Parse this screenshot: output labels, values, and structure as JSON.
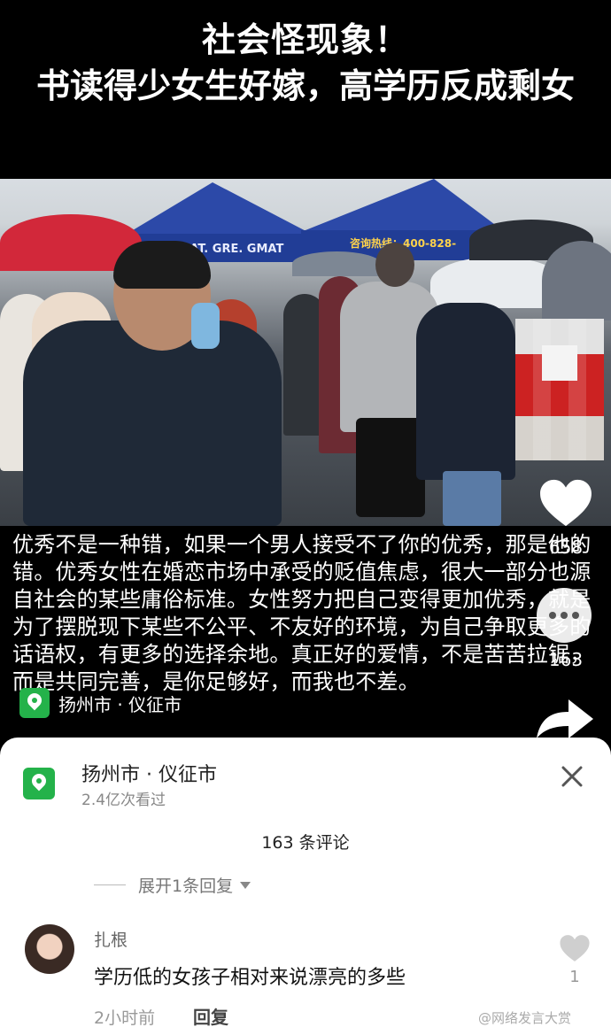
{
  "banner": {
    "line1": "社会怪现象！",
    "line2": "书读得少女生好嫁，高学历反成剩女"
  },
  "photo": {
    "tent_text_left": "SAT. GRE. GMAT",
    "tent_text_right": "咨询热线：400-828-"
  },
  "caption": {
    "text": "优秀不是一种错，如果一个男人接受不了你的优秀，那是他的错。优秀女性在婚恋市场中承受的贬值焦虑，很大一部分也源自社会的某些庸俗标准。女性努力把自己变得更加优秀，就是为了摆脱现下某些不公平、不友好的环境，为自己争取更多的话语权，有更多的选择余地。真正好的爱情，不是苦苦拉锯，而是共同完善，是你足够好，而我也不差。"
  },
  "location_chip": {
    "label": "扬州市 · 仪征市"
  },
  "side": {
    "like_count": "658",
    "comment_count": "163"
  },
  "sheet": {
    "location": "扬州市 · 仪征市",
    "views": "2.4亿次看过",
    "comments_header": "163 条评论",
    "expand_replies": "展开1条回复",
    "comment": {
      "user": "扎根",
      "text": "学历低的女孩子相对来说漂亮的多些",
      "time": "2小时前",
      "reply_label": "回复",
      "likes": "1"
    }
  },
  "watermark": "@网络发言大赏",
  "colors": {
    "pin_green": "#24b24a",
    "tent_blue": "#1f3f9a"
  }
}
